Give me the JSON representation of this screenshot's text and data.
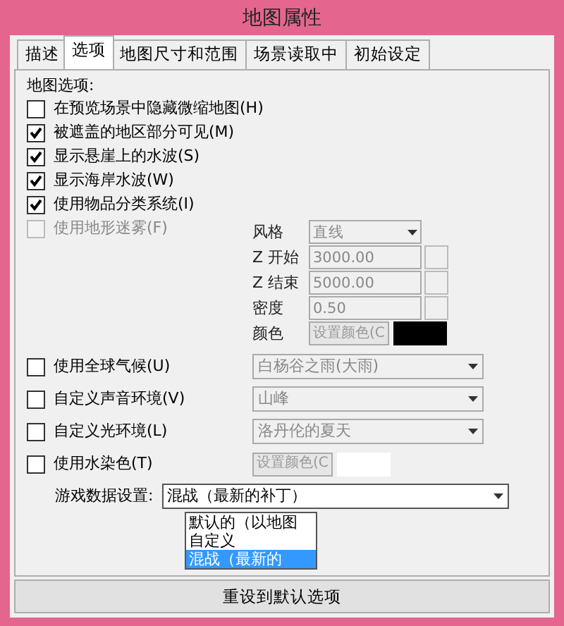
{
  "window": {
    "title": "地图属性"
  },
  "tabs": [
    {
      "label": "描述",
      "selected": false
    },
    {
      "label": "选项",
      "selected": true
    },
    {
      "label": "地图尺寸和范围",
      "selected": false
    },
    {
      "label": "场景读取中",
      "selected": false
    },
    {
      "label": "初始设定",
      "selected": false
    }
  ],
  "group_label": "地图选项:",
  "options": [
    {
      "label": "在预览场景中隐藏微缩地图(H)",
      "checked": false,
      "disabled": false
    },
    {
      "label": "被遮盖的地区部分可见(M)",
      "checked": true,
      "disabled": false
    },
    {
      "label": "显示悬崖上的水波(S)",
      "checked": true,
      "disabled": false
    },
    {
      "label": "显示海岸水波(W)",
      "checked": true,
      "disabled": false
    },
    {
      "label": "使用物品分类系统(I)",
      "checked": true,
      "disabled": false
    },
    {
      "label": "使用地形迷雾(F)",
      "checked": false,
      "disabled": true
    }
  ],
  "fog": [
    {
      "kind": "select",
      "label": "风格",
      "value": "直线"
    },
    {
      "kind": "spin",
      "label": "Z 开始",
      "value": "3000.00"
    },
    {
      "kind": "spin",
      "label": "Z 结束",
      "value": "5000.00"
    },
    {
      "kind": "spin",
      "label": "密度",
      "value": "0.50"
    },
    {
      "kind": "color",
      "label": "颜色",
      "button": "设置颜色(C",
      "color": "#000000"
    }
  ],
  "environment": [
    {
      "kind": "select",
      "label": "使用全球气候(U)",
      "checked": false,
      "value": "白杨谷之雨(大雨)"
    },
    {
      "kind": "select",
      "label": "自定义声音环境(V)",
      "checked": false,
      "value": "山峰"
    },
    {
      "kind": "select",
      "label": "自定义光环境(L)",
      "checked": false,
      "value": "洛丹伦的夏天"
    },
    {
      "kind": "color",
      "label": "使用水染色(T)",
      "checked": false,
      "button": "设置颜色(C",
      "color": "#ffffff"
    }
  ],
  "game_data": {
    "label": "游戏数据设置:",
    "value": "混战（最新的补丁）",
    "expanded": true,
    "options": [
      {
        "label": "默认的（以地图",
        "selected": false
      },
      {
        "label": "自定义",
        "selected": false
      },
      {
        "label": "混战（最新的",
        "selected": true
      }
    ]
  },
  "reset_button": "重设到默认选项"
}
